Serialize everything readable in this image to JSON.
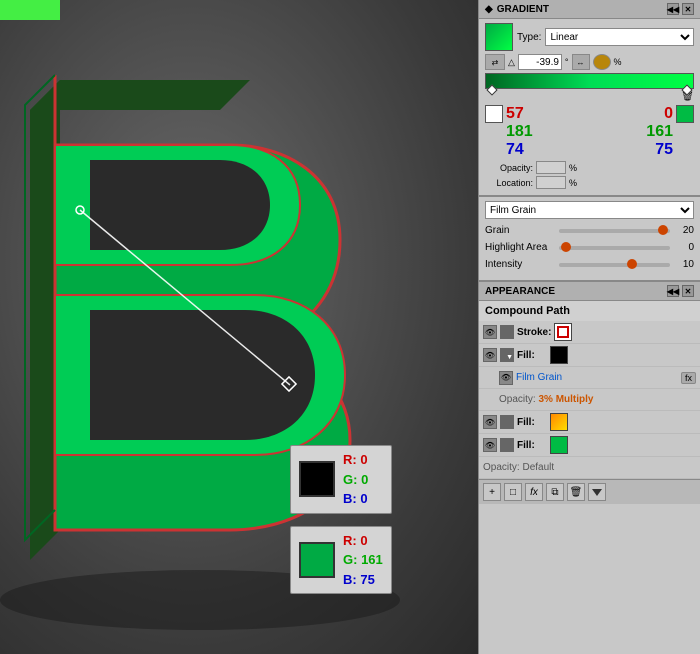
{
  "canvas": {
    "background": "dark gray gradient"
  },
  "gradient_panel": {
    "title": "GRADIENT",
    "type_label": "Type:",
    "type_value": "Linear",
    "angle_value": "-39.9",
    "angle_symbol": "°",
    "color_left": {
      "r": "57",
      "g": "181",
      "b": "74",
      "opacity_label": "Opacity:",
      "opacity_value": "",
      "location_label": "Location:",
      "location_value": ""
    },
    "color_right": {
      "r": "0",
      "g": "161",
      "b": "75"
    }
  },
  "filmgrain_panel": {
    "title": "Film Grain",
    "grain_label": "Grain",
    "grain_value": "20",
    "highlight_label": "Highlight Area",
    "highlight_value": "0",
    "intensity_label": "Intensity",
    "intensity_value": "10"
  },
  "appearance_panel": {
    "title": "APPEARANCE",
    "compound_path": "Compound Path",
    "stroke_label": "Stroke:",
    "fill_label": "Fill:",
    "film_grain_label": "Film Grain",
    "opacity_label": "Opacity:",
    "opacity_value": "3% Multiply",
    "fill2_label": "Fill:",
    "fill3_label": "Fill:",
    "opacity2_label": "Opacity:",
    "opacity2_value": "Default"
  },
  "swatches": {
    "black": {
      "r": "0",
      "g": "0",
      "b": "0"
    },
    "green": {
      "r": "0",
      "g": "161",
      "b": "75"
    }
  }
}
